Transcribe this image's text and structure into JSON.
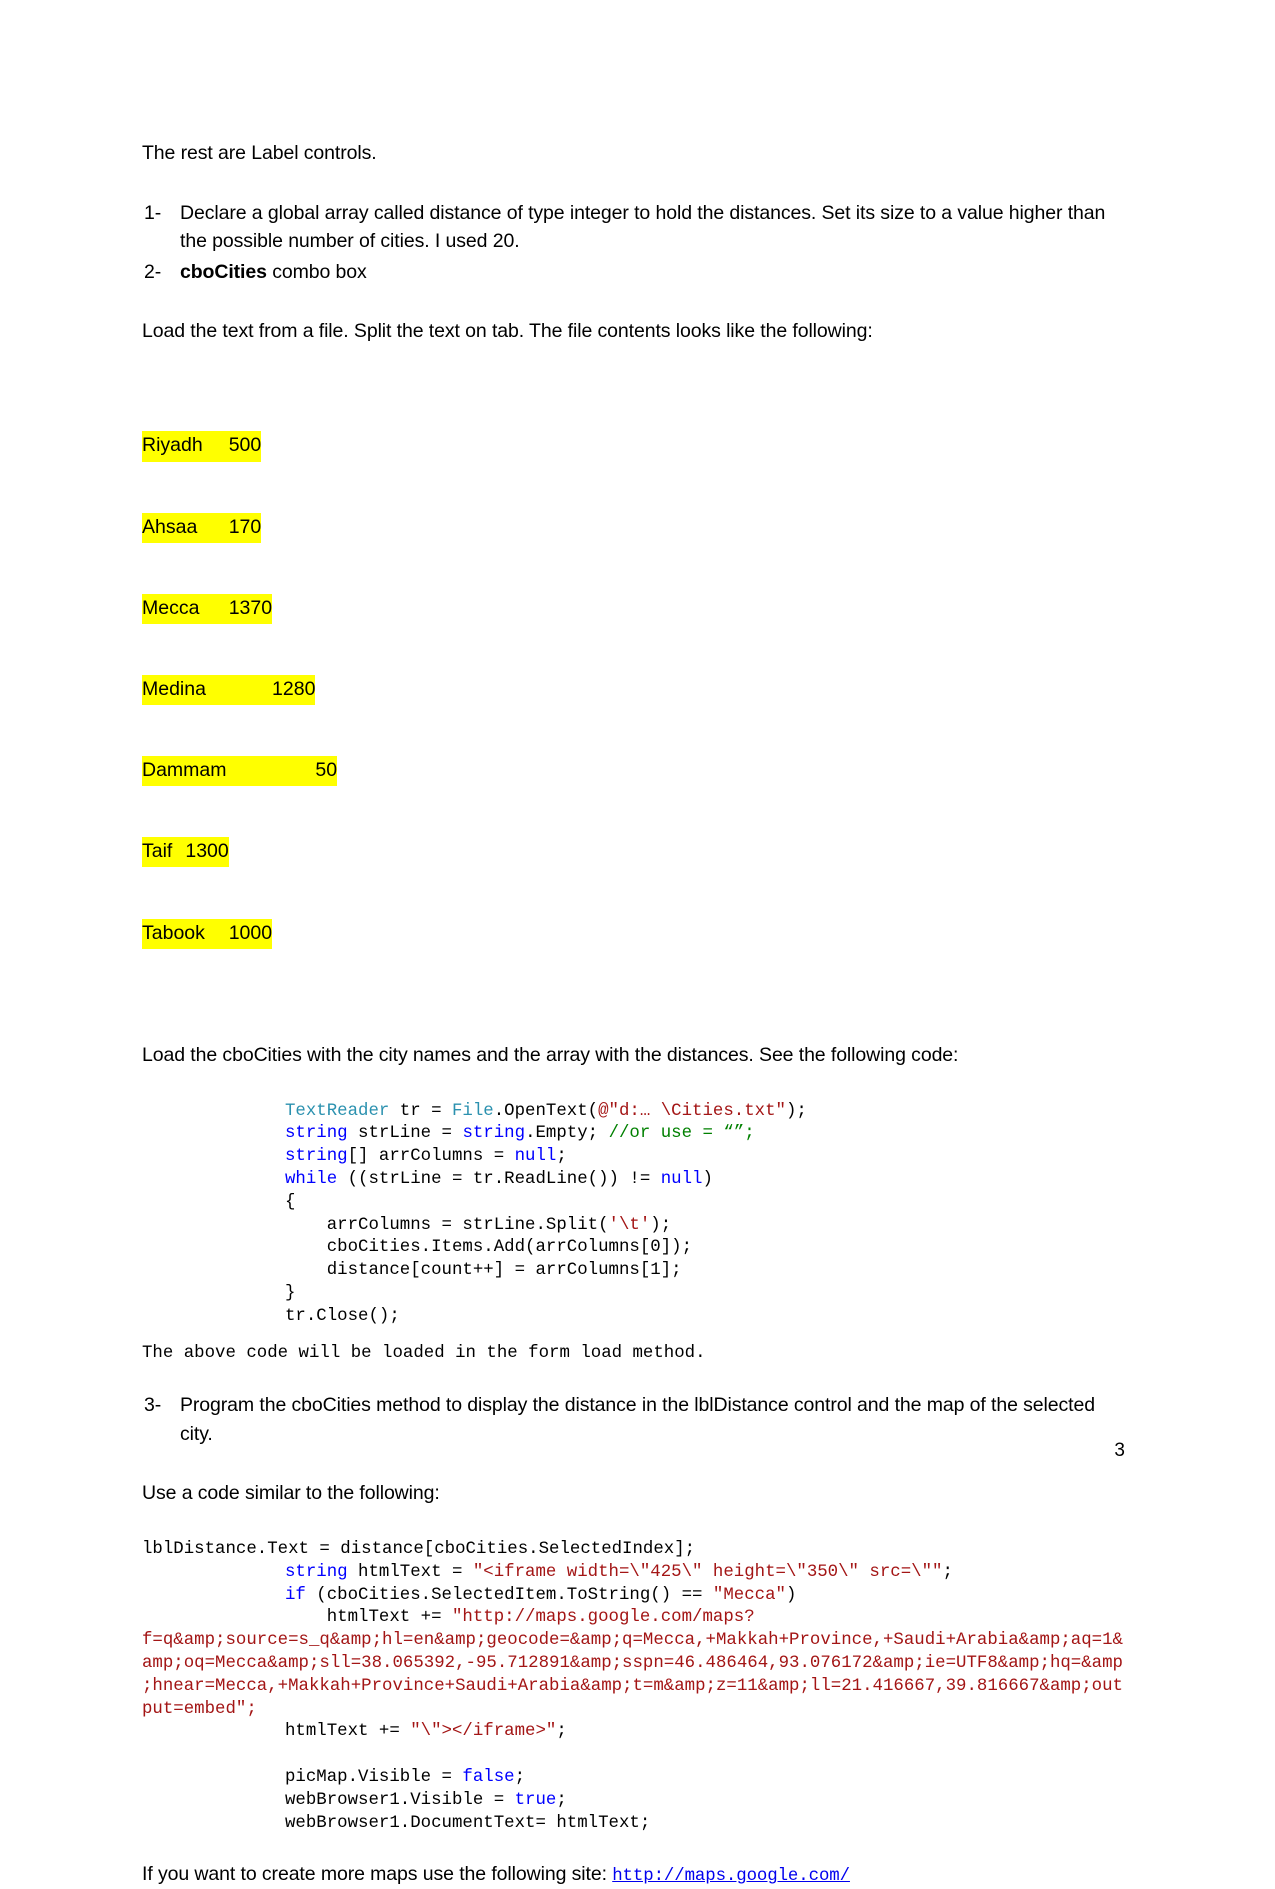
{
  "document": {
    "page_number": "3",
    "intro_line": "The rest are Label controls.",
    "numbered_items": [
      {
        "marker": "1-",
        "text": "Declare a global array called distance of type integer to hold the distances. Set its size to a value higher than the possible number of cities. I used 20."
      },
      {
        "marker": "2-",
        "bold_lead": "cboCities",
        "text": " combo box"
      },
      {
        "marker": "3-",
        "text": "Program the cboCities method to display the distance in the lblDistance control and the map of the selected city."
      }
    ],
    "load_text_paragraph": "Load the text from a file. Split the text on tab. The file contents looks like the following:",
    "load_combo_paragraph": "Load the cboCities with the city names and the array with the distances. See the following code:",
    "form_load_note": "The above code will be loaded in the form load method.",
    "use_code_paragraph": "Use a code similar to the following:",
    "more_maps_prefix": "If you want to create more maps use the following site: ",
    "more_maps_link": "http://maps.google.com/"
  },
  "highlighted_data": {
    "highlight_color": "#ffff00",
    "rows": [
      {
        "city": "Riyadh",
        "distance": "500",
        "text": "Riyadh\t500"
      },
      {
        "city": "Ahsaa",
        "distance": "170",
        "text": "Ahsaa\t170"
      },
      {
        "city": "Mecca",
        "distance": "1370",
        "text": "Mecca\t1370"
      },
      {
        "city": "Medina",
        "distance": "1280",
        "text": "Medina\t\t1280"
      },
      {
        "city": "Dammam",
        "distance": "50",
        "text": "Dammam\t\t50"
      },
      {
        "city": "Taif",
        "distance": "1300",
        "text": "Taif\t1300"
      },
      {
        "city": "Tabook",
        "distance": "1000",
        "text": "Tabook\t1000"
      }
    ]
  },
  "code_block_1": {
    "lines": [
      [
        {
          "t": "TextReader",
          "c": "type"
        },
        {
          "t": " tr = ",
          "c": "plain"
        },
        {
          "t": "File",
          "c": "type"
        },
        {
          "t": ".OpenText(",
          "c": "plain"
        },
        {
          "t": "@\"d:… \\Cities.txt\"",
          "c": "str"
        },
        {
          "t": ");",
          "c": "plain"
        }
      ],
      [
        {
          "t": "string",
          "c": "kw"
        },
        {
          "t": " strLine = ",
          "c": "plain"
        },
        {
          "t": "string",
          "c": "kw"
        },
        {
          "t": ".Empty; ",
          "c": "plain"
        },
        {
          "t": "//or use = “”;",
          "c": "cmt"
        }
      ],
      [
        {
          "t": "string",
          "c": "kw"
        },
        {
          "t": "[] arrColumns = ",
          "c": "plain"
        },
        {
          "t": "null",
          "c": "kw"
        },
        {
          "t": ";",
          "c": "plain"
        }
      ],
      [
        {
          "t": "while",
          "c": "kw"
        },
        {
          "t": " ((strLine = tr.ReadLine()) != ",
          "c": "plain"
        },
        {
          "t": "null",
          "c": "kw"
        },
        {
          "t": ")",
          "c": "plain"
        }
      ],
      [
        {
          "t": "{",
          "c": "plain"
        }
      ],
      [
        {
          "t": "    arrColumns = strLine.Split(",
          "c": "plain"
        },
        {
          "t": "'\\t'",
          "c": "str"
        },
        {
          "t": ");",
          "c": "plain"
        }
      ],
      [
        {
          "t": "    cboCities.Items.Add(arrColumns[0]);",
          "c": "plain"
        }
      ],
      [
        {
          "t": "    distance[count++] = arrColumns[1];",
          "c": "plain"
        }
      ],
      [
        {
          "t": "}",
          "c": "plain"
        }
      ],
      [
        {
          "t": "tr.Close();",
          "c": "plain"
        }
      ]
    ]
  },
  "code_block_2": {
    "lead_line": "lblDistance.Text = distance[cboCities.SelectedIndex];",
    "lines": [
      [
        {
          "t": "string",
          "c": "kw"
        },
        {
          "t": " htmlText = ",
          "c": "plain"
        },
        {
          "t": "\"<iframe width=\\\"425\\\" height=\\\"350\\\" src=\\\"\"",
          "c": "str"
        },
        {
          "t": ";",
          "c": "plain"
        }
      ],
      [
        {
          "t": "if",
          "c": "kw"
        },
        {
          "t": " (cboCities.SelectedItem.ToString() == ",
          "c": "plain"
        },
        {
          "t": "\"Mecca\"",
          "c": "str"
        },
        {
          "t": ")",
          "c": "plain"
        }
      ],
      [
        {
          "t": "    htmlText += ",
          "c": "plain"
        },
        {
          "t": "\"http://maps.google.com/maps?",
          "c": "str"
        }
      ]
    ],
    "url_continuation": "f=q&amp;source=s_q&amp;hl=en&amp;geocode=&amp;q=Mecca,+Makkah+Province,+Saudi+Arabia&amp;aq=1&amp;oq=Mecca&amp;sll=38.065392,-95.712891&amp;sspn=46.486464,93.076172&amp;ie=UTF8&amp;hq=&amp;hnear=Mecca,+Makkah+Province+Saudi+Arabia&amp;t=m&amp;z=11&amp;ll=21.416667,39.816667&amp;output=embed\";",
    "tail_lines": [
      [
        {
          "t": "htmlText += ",
          "c": "plain"
        },
        {
          "t": "\"\\\"></iframe>\"",
          "c": "str"
        },
        {
          "t": ";",
          "c": "plain"
        }
      ],
      [
        {
          "t": "",
          "c": "plain"
        }
      ],
      [
        {
          "t": "picMap.Visible = ",
          "c": "plain"
        },
        {
          "t": "false",
          "c": "kw"
        },
        {
          "t": ";",
          "c": "plain"
        }
      ],
      [
        {
          "t": "webBrowser1.Visible = ",
          "c": "plain"
        },
        {
          "t": "true",
          "c": "kw"
        },
        {
          "t": ";",
          "c": "plain"
        }
      ],
      [
        {
          "t": "webBrowser1.DocumentText= htmlText;",
          "c": "plain"
        }
      ]
    ]
  },
  "colors": {
    "keyword": "#0000ff",
    "type": "#2b91af",
    "string": "#a31515",
    "comment": "#008000",
    "link": "#0000ee",
    "highlight": "#ffff00"
  }
}
